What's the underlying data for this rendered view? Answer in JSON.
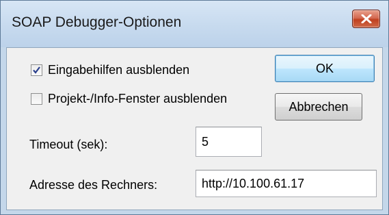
{
  "window": {
    "title": "SOAP Debugger-Optionen"
  },
  "options": {
    "hide_input_aids": {
      "label": "Eingabehilfen ausblenden",
      "checked": true
    },
    "hide_project_info": {
      "label": "Projekt-/Info-Fenster ausblenden",
      "checked": false
    }
  },
  "buttons": {
    "ok": "OK",
    "cancel": "Abbrechen"
  },
  "timeout": {
    "label": "Timeout (sek):",
    "value": "5"
  },
  "address": {
    "label": "Adresse des Rechners:",
    "value": "http://10.100.61.17"
  },
  "icons": {
    "close": "close-icon",
    "check": "checkmark-icon"
  },
  "colors": {
    "close_button": "#c0401f",
    "default_button_border": "#3c7fb1",
    "titlebar": "#c8dbef"
  }
}
